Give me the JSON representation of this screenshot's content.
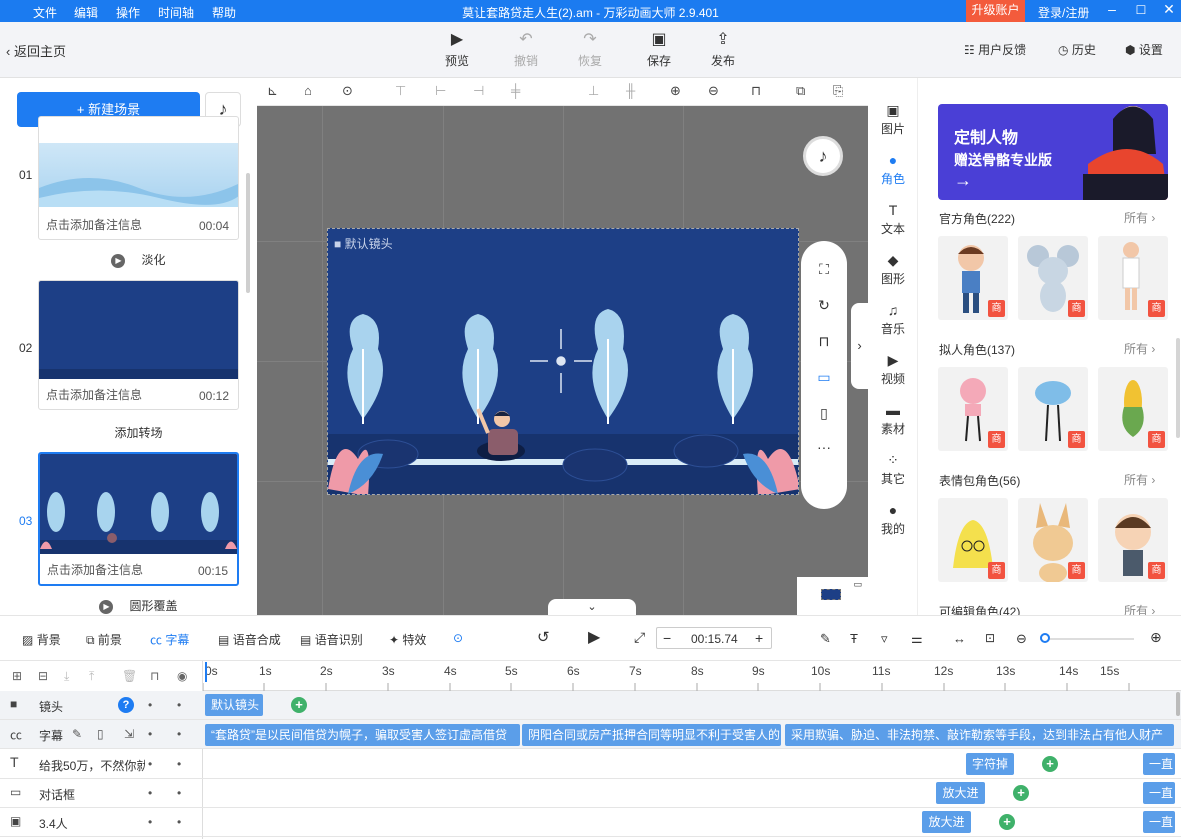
{
  "menu": [
    "文件",
    "编辑",
    "操作",
    "时间轴",
    "帮助"
  ],
  "window_title": "莫让套路贷走人生(2).am - 万彩动画大师 2.9.401",
  "upgrade_label": "升级账户",
  "login_label": "登录/注册",
  "toolbar": {
    "back_label": "返回主页",
    "preview_label": "预览",
    "undo_label": "撤销",
    "redo_label": "恢复",
    "save_label": "保存",
    "publish_label": "发布",
    "feedback_label": "用户反馈",
    "history_label": "历史",
    "settings_label": "设置"
  },
  "left": {
    "new_scene_label": "+ 新建场景",
    "scenes": [
      {
        "num": "01",
        "info": "点击添加备注信息",
        "dur": "00:04",
        "transition": "淡化"
      },
      {
        "num": "02",
        "info": "点击添加备注信息",
        "dur": "00:12",
        "transition": "添加转场"
      },
      {
        "num": "03",
        "info": "点击添加备注信息",
        "dur": "00:15",
        "transition": "圆形覆盖"
      }
    ]
  },
  "canvas": {
    "camera_label": "默认镜头"
  },
  "categories": [
    "图片",
    "角色",
    "文本",
    "图形",
    "音乐",
    "视频",
    "素材",
    "其它",
    "我的"
  ],
  "panel": {
    "banner_line1": "定制人物",
    "banner_line2": "赠送骨骼专业版",
    "sections": [
      {
        "title": "官方角色(222)",
        "all": "所有 ›"
      },
      {
        "title": "拟人角色(137)",
        "all": "所有 ›"
      },
      {
        "title": "表情包角色(56)",
        "all": "所有 ›"
      },
      {
        "title": "可编辑角色(42)",
        "all": "所有 ›"
      }
    ],
    "badge": "商"
  },
  "timeline_tools": {
    "bg": "背景",
    "fg": "前景",
    "subtitle": "字幕",
    "tts": "语音合成",
    "asr": "语音识别",
    "fx": "特效",
    "time": "00:15.74"
  },
  "ruler": [
    "0s",
    "1s",
    "2s",
    "3s",
    "4s",
    "5s",
    "6s",
    "7s",
    "8s",
    "9s",
    "10s",
    "11s",
    "12s",
    "13s",
    "14s",
    "15s"
  ],
  "tracks": {
    "camera": {
      "name": "镜头",
      "clip": "默认镜头"
    },
    "subtitle": {
      "name": "字幕",
      "clips": [
        "“套路贷”是以民间借贷为幌子，骗取受害人签订虚高借贷",
        "阴阳合同或房产抵押合同等明显不利于受害人的",
        "采用欺骗、胁迫、非法拘禁、敲诈勒索等手段，达到非法占有他人财产"
      ]
    },
    "text": {
      "name": "给我50万，不然你就",
      "clip": "字符掉",
      "tail": "一直"
    },
    "dialog": {
      "name": "对话框",
      "clip": "放大进",
      "tail": "一直"
    },
    "image": {
      "name": "3.4人",
      "clip": "放大进",
      "tail": "一直"
    }
  },
  "colors": {
    "accent": "#1e7cf2",
    "title_bar": "#1b7bf0",
    "upgrade": "#f35b3c",
    "stage": "#1d3f86",
    "clip": "#5b9ee9"
  }
}
